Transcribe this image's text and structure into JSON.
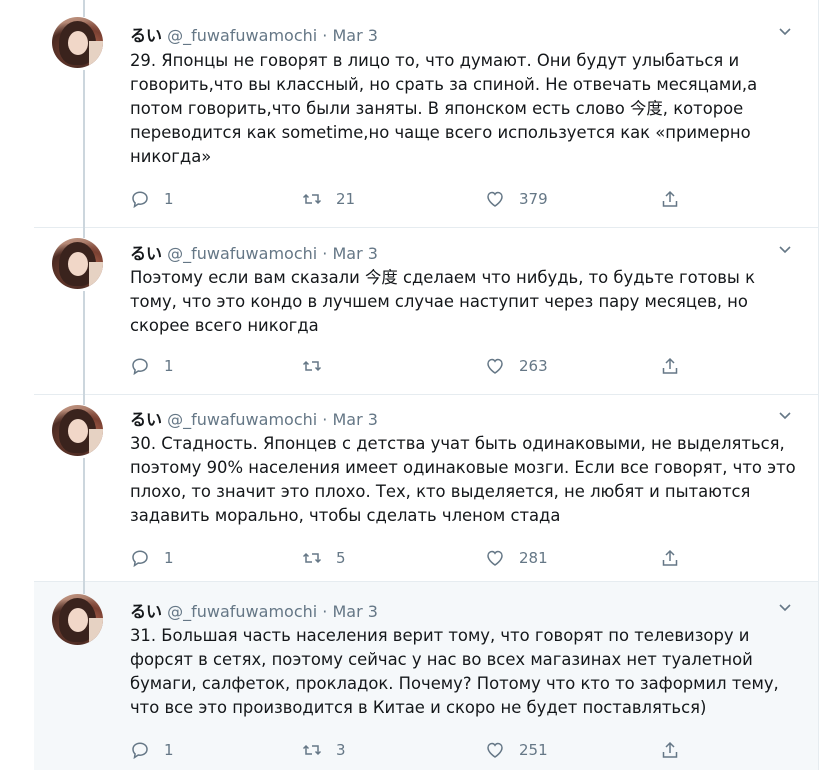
{
  "tweets": [
    {
      "name": "るい",
      "handle": "@_fuwafuwamochi",
      "separator": "·",
      "date": "Mar 3",
      "text": "29. Японцы не говорят в лицо то, что думают. Они будут улыбаться и говорить,что вы классный, но срать за спиной. Не отвечать месяцами,а потом говорить,что были заняты. В японском есть слово 今度, которое переводится как sometime,но чаще всего используется как «примерно никогда»",
      "replies": "1",
      "retweets": "21",
      "likes": "379"
    },
    {
      "name": "るい",
      "handle": "@_fuwafuwamochi",
      "separator": "·",
      "date": "Mar 3",
      "text": "Поэтому если вам сказали 今度 сделаем что нибудь, то будьте готовы к тому, что это кондо в лучшем случае наступит через пару месяцев, но скорее всего никогда",
      "replies": "1",
      "retweets": "",
      "likes": "263"
    },
    {
      "name": "るい",
      "handle": "@_fuwafuwamochi",
      "separator": "·",
      "date": "Mar 3",
      "text": "30. Стадность. Японцев с детства учат быть одинаковыми, не выделяться, поэтому 90% населения имеет одинаковые мозги. Если все говорят, что это плохо, то значит это плохо. Тех, кто выделяется, не любят и пытаются задавить морально, чтобы сделать членом стада",
      "replies": "1",
      "retweets": "5",
      "likes": "281"
    },
    {
      "name": "るい",
      "handle": "@_fuwafuwamochi",
      "separator": "·",
      "date": "Mar 3",
      "text": "31. Большая часть населения верит тому, что говорят по телевизору и форсят в сетях, поэтому сейчас у нас во всех магазинах нет туалетной бумаги, салфеток, прокладок. Почему? Потому что кто то заформил тему, что все это производится в Китае и скоро не будет поставляться)",
      "replies": "1",
      "retweets": "3",
      "likes": "251"
    }
  ],
  "colors": {
    "text": "#14171a",
    "secondary": "#657786",
    "border": "#e6ecf0",
    "thread_line": "#ccd6dd",
    "highlight_bg": "#f5f8fa"
  },
  "icons": [
    "reply-icon",
    "retweet-icon",
    "like-icon",
    "share-icon",
    "chevron-down-icon"
  ]
}
